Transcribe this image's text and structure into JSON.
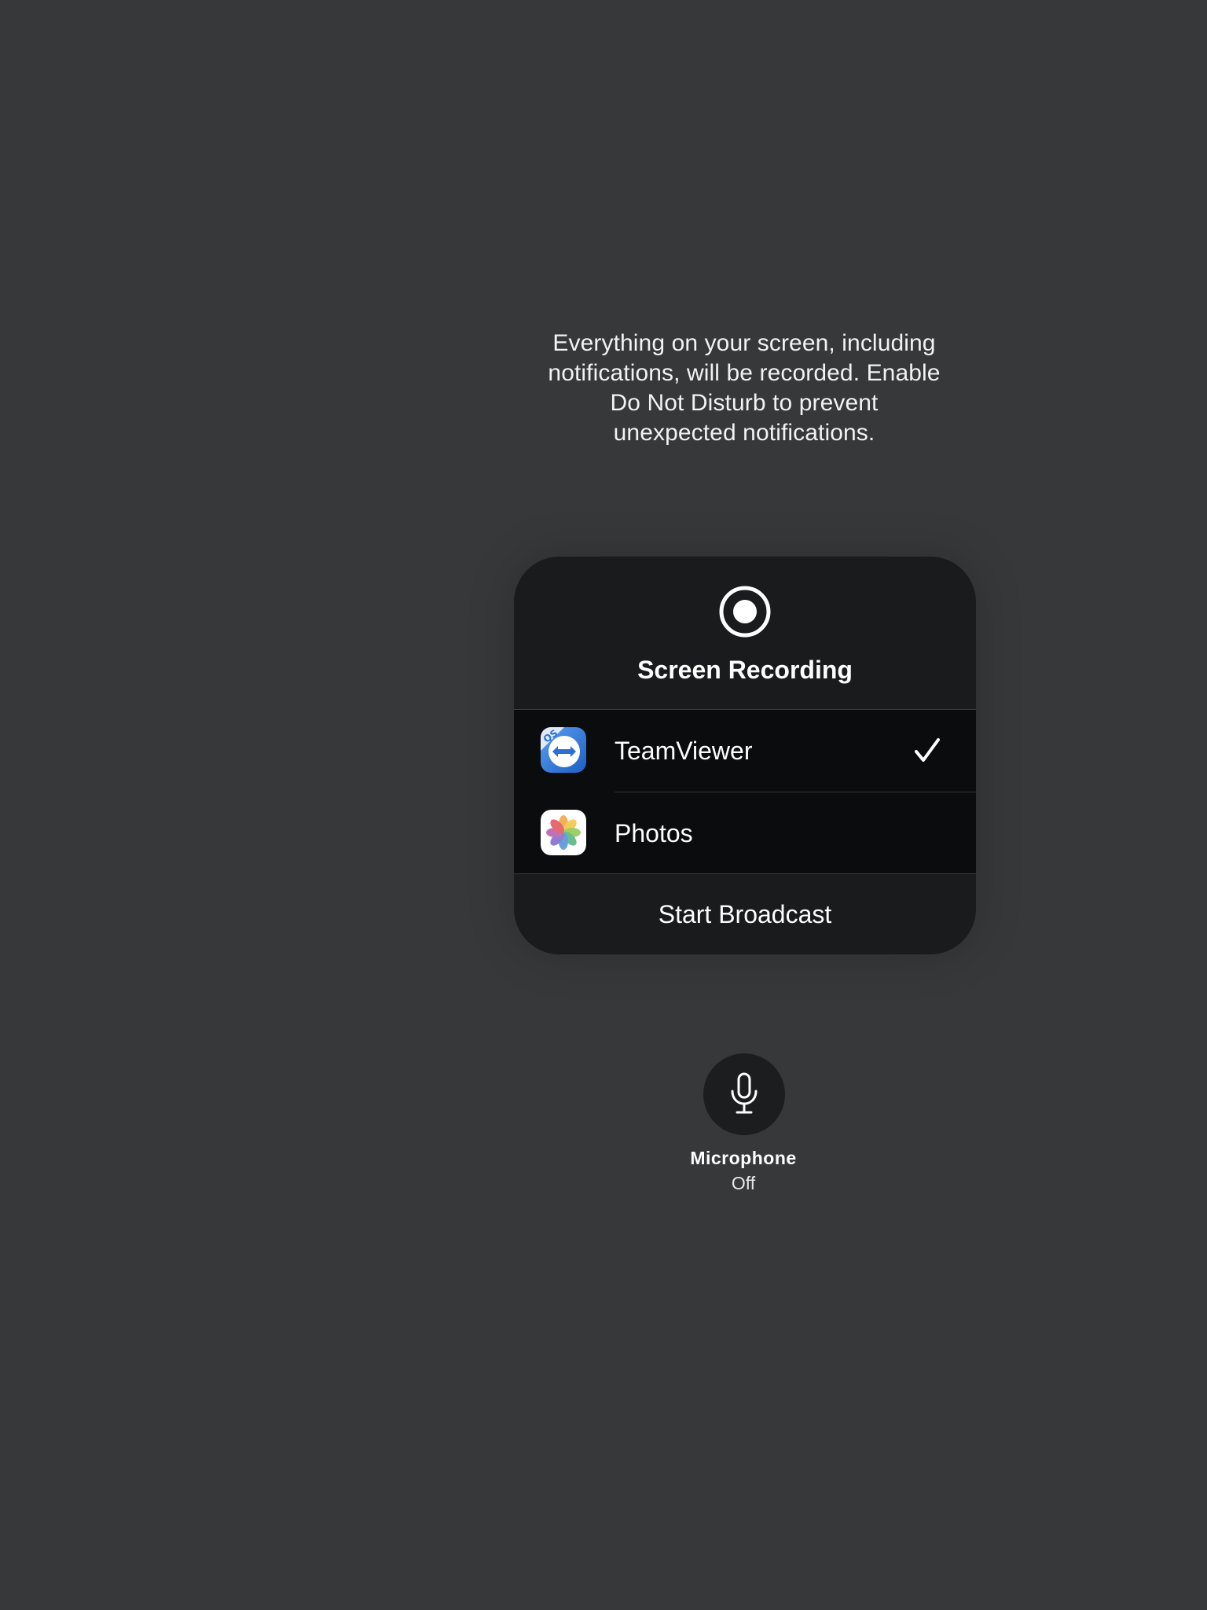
{
  "notice": {
    "lines": [
      "Everything on your screen, including",
      "notifications, will be recorded. Enable",
      "Do Not Disturb to prevent",
      "unexpected notifications."
    ]
  },
  "panel": {
    "icon": "record-icon",
    "title": "Screen Recording",
    "apps": [
      {
        "label": "TeamViewer",
        "icon": "teamviewer-icon",
        "selected": true
      },
      {
        "label": "Photos",
        "icon": "photos-icon",
        "selected": false
      }
    ],
    "start_label": "Start Broadcast"
  },
  "microphone": {
    "icon": "microphone-icon",
    "label": "Microphone",
    "status": "Off"
  },
  "colors": {
    "background": "#37383a",
    "panel": "#1a1b1d",
    "list": "#0b0c0e",
    "text": "#ffffff",
    "teamviewer_blue": "#2d6fd2"
  }
}
